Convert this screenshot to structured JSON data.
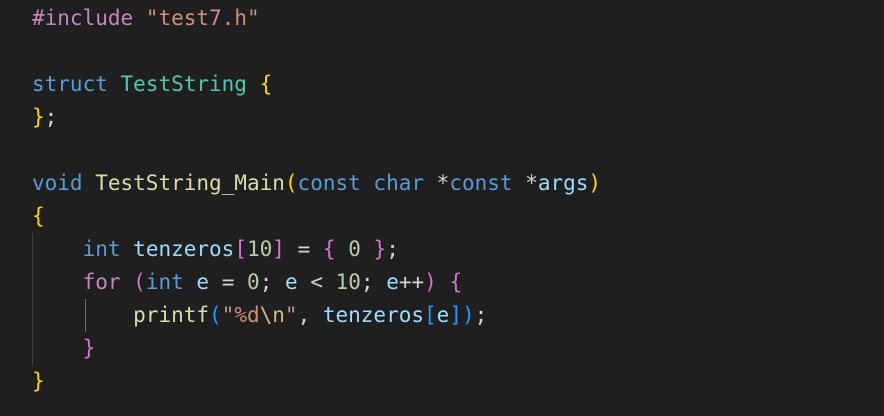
{
  "editor": {
    "language": "c",
    "colors": {
      "background": "#1f1f1f",
      "keyword": "#569cd6",
      "control_keyword": "#c586c0",
      "type": "#4ec9b0",
      "function": "#dcdcaa",
      "variable": "#9cdcfe",
      "number": "#b5cea8",
      "string": "#ce9178",
      "escape": "#d7ba7d",
      "bracket_level_1": "#ffd700",
      "bracket_level_2": "#da70d6",
      "bracket_level_3": "#179fff"
    },
    "lines": [
      [
        [
          "pp",
          "#include"
        ],
        [
          "plain",
          " "
        ],
        [
          "str",
          "\"test7.h\""
        ]
      ],
      [],
      [
        [
          "kw",
          "struct"
        ],
        [
          "plain",
          " "
        ],
        [
          "type",
          "TestString"
        ],
        [
          "plain",
          " "
        ],
        [
          "b1",
          "{"
        ]
      ],
      [
        [
          "b1",
          "}"
        ],
        [
          "plain",
          ";"
        ]
      ],
      [],
      [
        [
          "kw",
          "void"
        ],
        [
          "plain",
          " "
        ],
        [
          "fn",
          "TestString_Main"
        ],
        [
          "b1",
          "("
        ],
        [
          "kw",
          "const"
        ],
        [
          "plain",
          " "
        ],
        [
          "kw",
          "char"
        ],
        [
          "plain",
          " "
        ],
        [
          "op",
          "*"
        ],
        [
          "kw",
          "const"
        ],
        [
          "plain",
          " "
        ],
        [
          "op",
          "*"
        ],
        [
          "var",
          "args"
        ],
        [
          "b1",
          ")"
        ]
      ],
      [
        [
          "b1",
          "{"
        ]
      ],
      [
        [
          "plain",
          "    "
        ],
        [
          "kw",
          "int"
        ],
        [
          "plain",
          " "
        ],
        [
          "var",
          "tenzeros"
        ],
        [
          "b2",
          "["
        ],
        [
          "num",
          "10"
        ],
        [
          "b2",
          "]"
        ],
        [
          "plain",
          " "
        ],
        [
          "op",
          "="
        ],
        [
          "plain",
          " "
        ],
        [
          "b2",
          "{"
        ],
        [
          "plain",
          " "
        ],
        [
          "num",
          "0"
        ],
        [
          "plain",
          " "
        ],
        [
          "b2",
          "}"
        ],
        [
          "plain",
          ";"
        ]
      ],
      [
        [
          "plain",
          "    "
        ],
        [
          "kw2",
          "for"
        ],
        [
          "plain",
          " "
        ],
        [
          "b2",
          "("
        ],
        [
          "kw",
          "int"
        ],
        [
          "plain",
          " "
        ],
        [
          "var",
          "e"
        ],
        [
          "plain",
          " "
        ],
        [
          "op",
          "="
        ],
        [
          "plain",
          " "
        ],
        [
          "num",
          "0"
        ],
        [
          "plain",
          "; "
        ],
        [
          "var",
          "e"
        ],
        [
          "plain",
          " "
        ],
        [
          "op",
          "<"
        ],
        [
          "plain",
          " "
        ],
        [
          "num",
          "10"
        ],
        [
          "plain",
          "; "
        ],
        [
          "var",
          "e"
        ],
        [
          "op",
          "++"
        ],
        [
          "b2",
          ")"
        ],
        [
          "plain",
          " "
        ],
        [
          "b2",
          "{"
        ]
      ],
      [
        [
          "plain",
          "        "
        ],
        [
          "fn",
          "printf"
        ],
        [
          "b3",
          "("
        ],
        [
          "str",
          "\"%d"
        ],
        [
          "esc",
          "\\n"
        ],
        [
          "str",
          "\""
        ],
        [
          "plain",
          ", "
        ],
        [
          "var",
          "tenzeros"
        ],
        [
          "b3",
          "["
        ],
        [
          "var",
          "e"
        ],
        [
          "b3",
          "]"
        ],
        [
          "b3",
          ")"
        ],
        [
          "plain",
          ";"
        ]
      ],
      [
        [
          "plain",
          "    "
        ],
        [
          "b2",
          "}"
        ]
      ],
      [
        [
          "b1",
          "}"
        ]
      ]
    ]
  }
}
